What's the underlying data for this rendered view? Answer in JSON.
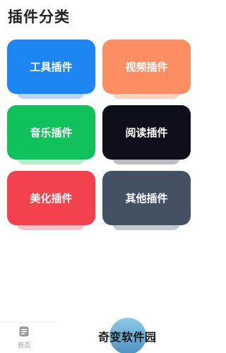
{
  "header": {
    "title": "插件分类"
  },
  "categories": [
    {
      "label": "工具插件",
      "color": "#1d86f3",
      "shadow_color": "#b7d6f7"
    },
    {
      "label": "视频插件",
      "color": "#fd8e62",
      "shadow_color": "#f9d3c2"
    },
    {
      "label": "音乐插件",
      "color": "#11c15b",
      "shadow_color": "#b8ecca"
    },
    {
      "label": "阅读插件",
      "color": "#0f0f1c",
      "shadow_color": "#bdbdc3"
    },
    {
      "label": "美化插件",
      "color": "#f3424d",
      "shadow_color": "#f8c3c6"
    },
    {
      "label": "其他插件",
      "color": "#435163",
      "shadow_color": "#c3c8d0"
    }
  ],
  "bottom_nav": {
    "home_label": "首页",
    "home_icon": "document-icon"
  },
  "watermark": {
    "text": "奇变软件园"
  }
}
